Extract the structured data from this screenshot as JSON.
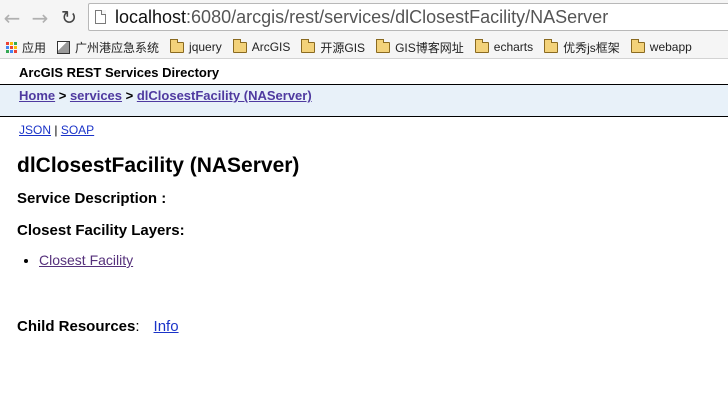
{
  "browser": {
    "url_host": "localhost",
    "url_rest": ":6080/arcgis/rest/services/dlClosestFacility/NAServer",
    "bookmarks": [
      {
        "label": "应用",
        "icon": "apps-grid-icon"
      },
      {
        "label": "广州港应急系统",
        "icon": "site-icon"
      },
      {
        "label": "jquery",
        "icon": "folder-icon"
      },
      {
        "label": "ArcGIS",
        "icon": "folder-icon"
      },
      {
        "label": "开源GIS",
        "icon": "folder-icon"
      },
      {
        "label": "GIS博客网址",
        "icon": "folder-icon"
      },
      {
        "label": "echarts",
        "icon": "folder-icon"
      },
      {
        "label": "优秀js框架",
        "icon": "folder-icon"
      },
      {
        "label": "webapp",
        "icon": "folder-icon"
      }
    ]
  },
  "page": {
    "directory_title": "ArcGIS REST Services Directory",
    "breadcrumb": {
      "home": "Home",
      "sep1": " > ",
      "services": "services",
      "sep2": " > ",
      "current": "dlClosestFacility (NAServer)"
    },
    "formats": {
      "json": "JSON",
      "sep": " | ",
      "soap": "SOAP"
    },
    "service_name": "dlClosestFacility (NAServer)",
    "service_description_label": "Service Description :",
    "layers_label": "Closest Facility Layers:",
    "layers": [
      "Closest Facility"
    ],
    "child_resources_label": "Child Resources",
    "child_resources_colon": ":",
    "child_resources_link": "Info"
  }
}
